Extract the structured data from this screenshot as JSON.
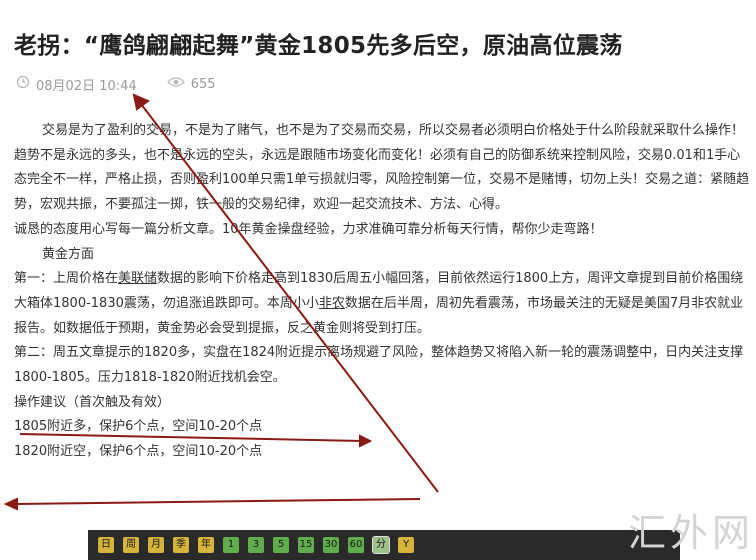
{
  "title": "老拐：“鹰鸽翩翩起舞”黄金1805先多后空，原油高位震荡",
  "meta": {
    "clock_icon": "clock-icon",
    "date": "08月02日 10:44",
    "eye_icon": "eye-icon",
    "views": "655"
  },
  "article": {
    "intro": "交易是为了盈利的交易，不是为了赌气，也不是为了交易而交易，所以交易者必须明白价格处于什么阶段就采取什么操作！趋势不是永远的多头，也不是永远的空头，永远是跟随市场变化而变化！必须有自己的防御系统来控制风险，交易0.01和1手心态完全不一样，严格止损，否则盈利100单只需1单亏损就归零，风险控制第一位，交易不是赌博，切勿上头！交易之道：紧随趋势，宏观共振，不要孤注一掷，铁一般的交易纪律，欢迎一起交流技术、方法、心得。",
    "sincere": "诚恳的态度用心写每一篇分析文章。10年黄金操盘经验，力求准确可靠分析每天行情，帮你少走弯路！",
    "gold_heading": "黄金方面",
    "p1_a": "第一：上周价格在",
    "p1_link1": "美联储",
    "p1_b": "数据的影响下价格走高到1830后周五小幅回落，目前依然运行1800上方，周评文章提到目前价格围绕大箱体1800-1830震荡，勿追涨追跌即可。本周小小",
    "p1_link2": "非农",
    "p1_c": "数据在后半周，周初先看震荡，市场最关注的无疑是美国7月非农就业报告。如数据低于预期，黄金势必会受到提振，反之黄金则将受到打压。",
    "p2": "第二：周五文章提示的1820多，实盘在1824附近提示离场规避了风险，整体趋势又将陷入新一轮的震荡调整中，日内关注支撑1800-1805。压力1818-1820附近找机会空。",
    "advice": "操作建议（首次触及有效）",
    "line1": "1805附近多，保护6个点，空间10-20个点",
    "line2": "1820附近空，保护6个点，空间10-20个点"
  },
  "toolbar": {
    "buttons": [
      "日",
      "周",
      "月",
      "季",
      "年",
      "1",
      "3",
      "5",
      "15",
      "30",
      "60",
      "分",
      "Y"
    ],
    "colors": [
      "#d6b33a",
      "#d6b33a",
      "#d6b33a",
      "#d6b33a",
      "#d6b33a",
      "#5fae4b",
      "#5fae4b",
      "#5fae4b",
      "#5fae4b",
      "#5fae4b",
      "#5fae4b",
      "#9ec28c",
      "#d6b33a"
    ]
  },
  "watermark": "汇外网",
  "annotation_color": "#8b1a14"
}
